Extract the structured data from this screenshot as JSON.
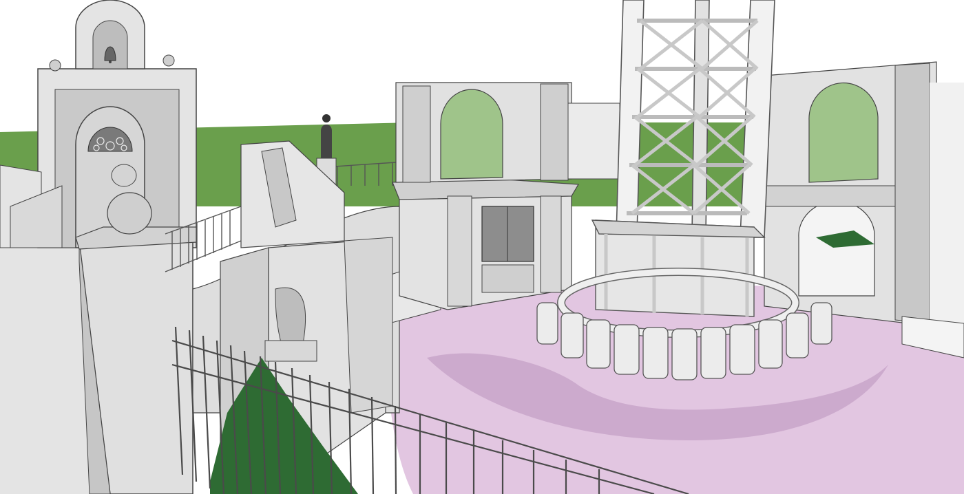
{
  "scene": {
    "kind": "3D architectural sketch render of a drop-tower ride plaza",
    "colors": {
      "sky": "#ffffff",
      "grass": "#6a9f4c",
      "grass_light": "#88b56a",
      "plaza": "#e2c6e1",
      "plaza_shadow": "#c7a3c8",
      "stone": "#e4e4e4",
      "stone_shade": "#c9c9c9",
      "stone_dark": "#a9a9a9",
      "outline": "#444444",
      "metal": "#f2f2f2",
      "metal_shade": "#bdbdbd",
      "ground_green": "#2e6b33",
      "fence": "#555555"
    },
    "icons": [
      "bell-icon",
      "statue-figure",
      "drop-tower-lattice",
      "seat-ring",
      "arched-ruin-wall",
      "gate-pillar",
      "iron-fence"
    ]
  }
}
